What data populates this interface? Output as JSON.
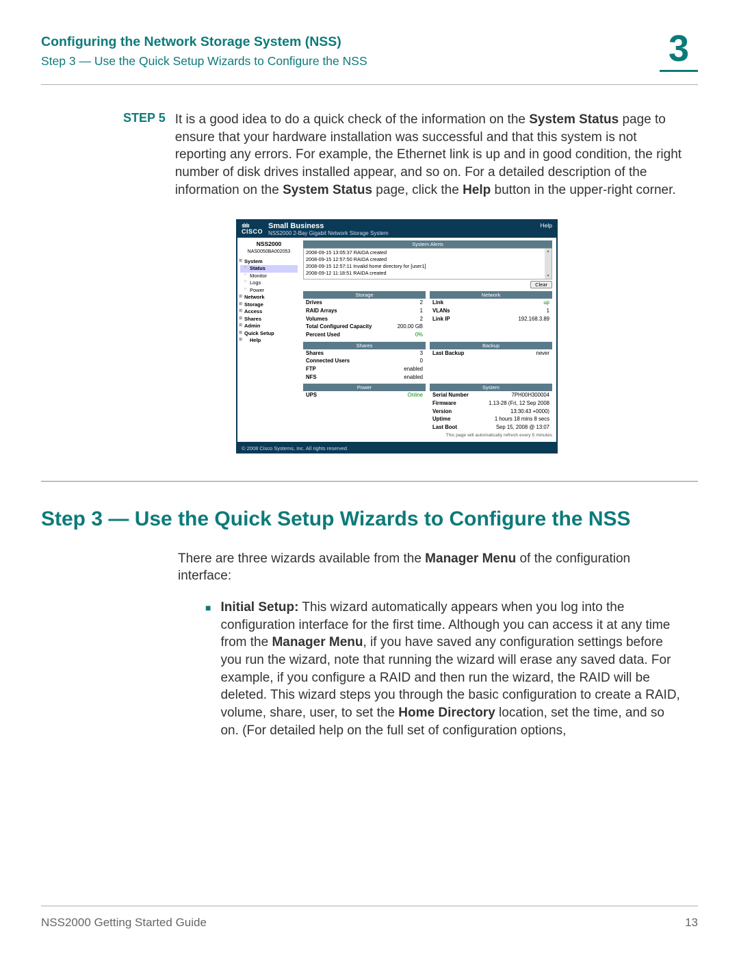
{
  "header": {
    "title": "Configuring the Network Storage System (NSS)",
    "subtitle": "Step 3 — Use the Quick Setup Wizards to Configure the NSS",
    "chapter_number": "3"
  },
  "step5": {
    "label": "STEP 5",
    "t1": "It is a good idea to do a quick check of the information on the ",
    "b1": "System Status",
    "t2": " page to ensure that your hardware installation was successful and that this system is not reporting any errors. For example, the Ethernet link is up and in good condition, the right number of disk drives installed appear, and so on. For a detailed description of the information on the ",
    "b2": "System Status",
    "t3": " page, click the ",
    "b3": "Help",
    "t4": " button in the upper-right corner."
  },
  "screenshot": {
    "brand_line1": "Small Business",
    "brand_line2": "NSS2000 2-Bay Gigabit Network Storage System",
    "help": "Help",
    "device": "NSS2000",
    "device_id": "NAS0050BA002053",
    "nav": {
      "system": "System",
      "status": "Status",
      "monitor": "Monitor",
      "logs": "Logs",
      "power": "Power",
      "network": "Network",
      "storage": "Storage",
      "access": "Access",
      "shares": "Shares",
      "admin": "Admin",
      "quick": "Quick Setup",
      "help": "Help"
    },
    "sections": {
      "alerts": "System Alerts",
      "storage": "Storage",
      "network": "Network",
      "shares": "Shares",
      "backup": "Backup",
      "power": "Power",
      "system": "System"
    },
    "alerts": [
      "2008-09-15 13:05:37 RAIDA created",
      "2008-09-15 12:57:50 RAIDA created",
      "2008-09-15 12:57:11 Invalid home directory for [user1]",
      "2008-09-12 11:18:51 RAIDA created"
    ],
    "clear_btn": "Clear",
    "storage": {
      "drives_k": "Drives",
      "drives_v": "2",
      "raid_k": "RAID Arrays",
      "raid_v": "1",
      "volumes_k": "Volumes",
      "volumes_v": "2",
      "cap_k": "Total Configured Capacity",
      "cap_v": "200.00 GB",
      "pct_k": "Percent Used",
      "pct_v": "0%"
    },
    "network": {
      "link_k": "Link",
      "link_v": "up",
      "vlans_k": "VLANs",
      "vlans_v": "1",
      "ip_k": "Link IP",
      "ip_v": "192.168.3.89"
    },
    "shares": {
      "shares_k": "Shares",
      "shares_v": "3",
      "users_k": "Connected Users",
      "users_v": "0",
      "ftp_k": "FTP",
      "ftp_v": "enabled",
      "nfs_k": "NFS",
      "nfs_v": "enabled"
    },
    "backup": {
      "last_k": "Last Backup",
      "last_v": "never"
    },
    "power": {
      "ups_k": "UPS",
      "ups_v": "Online"
    },
    "system": {
      "serial_k": "Serial Number",
      "serial_v": "7PH00H300004",
      "fw_k": "Firmware Version",
      "fw_v": "1.13-28 (Fri, 12 Sep 2008 13:30:43 +0000)",
      "uptime_k": "Uptime",
      "uptime_v": "1 hours 18 mins 8 secs",
      "boot_k": "Last Boot",
      "boot_v": "Sep 15, 2008 @ 13:07"
    },
    "refresh_note": "This page will automatically refresh every 5 minutes",
    "copyright": "© 2008 Cisco Systems, Inc. All rights reserved."
  },
  "section_heading": "Step 3 — Use the Quick Setup Wizards to Configure the NSS",
  "intro_para": {
    "t1": "There are three wizards available from the ",
    "b1": "Manager Menu",
    "t2": " of the configuration interface:"
  },
  "bullet1": {
    "b1": "Initial Setup:",
    "t1": " This wizard automatically appears when you log into the configuration interface for the first time. Although you can access it at any time from the ",
    "b2": "Manager Menu",
    "t2": ", if you have saved any configuration settings before you run the wizard, note that running the wizard will erase any saved data. For example, if you configure a RAID and then run the wizard, the RAID will be deleted. This wizard steps you through the basic configuration to create a RAID, volume, share, user, to set the ",
    "b3": "Home Directory",
    "t3": " location, set the time, and so on. (For detailed help on the full set of configuration options,"
  },
  "footer": {
    "guide": "NSS2000 Getting Started Guide",
    "page": "13"
  }
}
